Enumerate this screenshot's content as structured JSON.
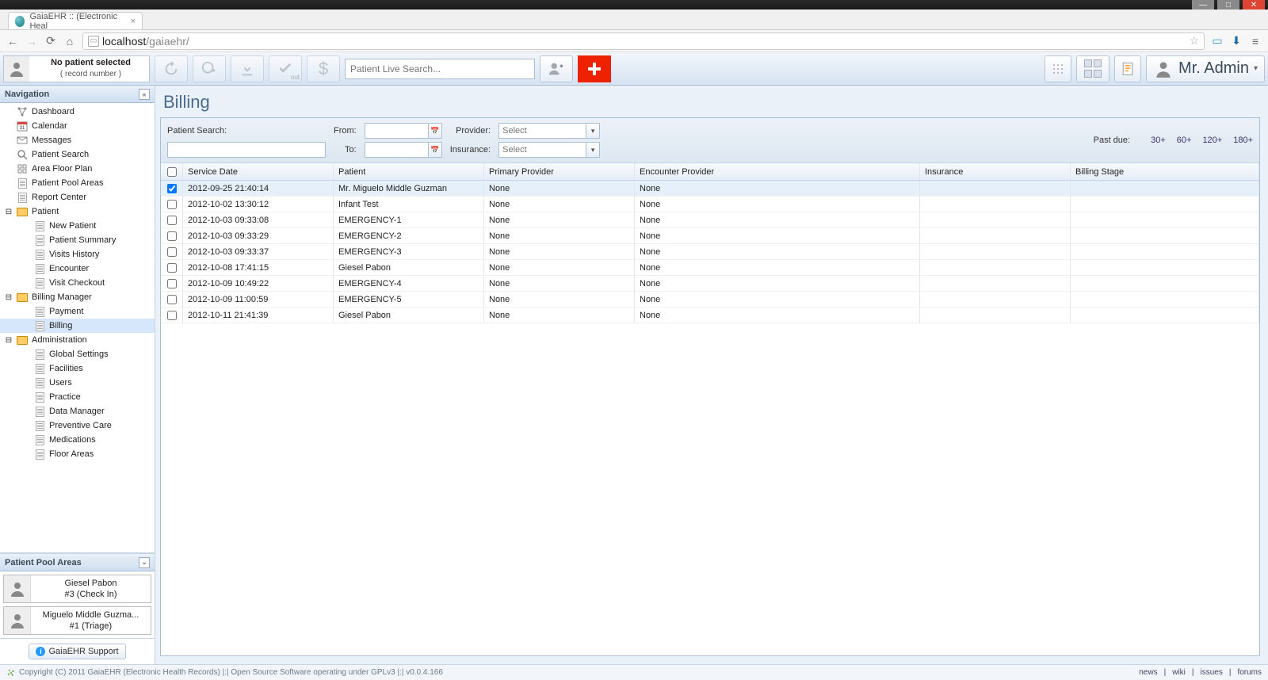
{
  "window": {
    "tab_title": "GaiaEHR :: (Electronic Heal",
    "url_host": "localhost",
    "url_path": "/gaiaehr/"
  },
  "toolbar": {
    "no_patient_line1": "No patient selected",
    "no_patient_line2": "( record number )",
    "search_placeholder": "Patient Live Search...",
    "checkout_sub": "out",
    "user_label": "Mr. Admin"
  },
  "nav_header": "Navigation",
  "nav": [
    {
      "id": "dashboard",
      "label": "Dashboard",
      "type": "item",
      "depth": 0,
      "icon": "nodes"
    },
    {
      "id": "calendar",
      "label": "Calendar",
      "type": "item",
      "depth": 0,
      "icon": "cal"
    },
    {
      "id": "messages",
      "label": "Messages",
      "type": "item",
      "depth": 0,
      "icon": "mail"
    },
    {
      "id": "psearch",
      "label": "Patient Search",
      "type": "item",
      "depth": 0,
      "icon": "search"
    },
    {
      "id": "floorplan",
      "label": "Area Floor Plan",
      "type": "item",
      "depth": 0,
      "icon": "grid"
    },
    {
      "id": "poolareas",
      "label": "Patient Pool Areas",
      "type": "item",
      "depth": 0,
      "icon": "doc"
    },
    {
      "id": "report",
      "label": "Report Center",
      "type": "item",
      "depth": 0,
      "icon": "doc"
    },
    {
      "id": "patient",
      "label": "Patient",
      "type": "folder",
      "depth": 0,
      "expanded": true
    },
    {
      "id": "newpatient",
      "label": "New Patient",
      "type": "item",
      "depth": 2,
      "icon": "doc"
    },
    {
      "id": "psummary",
      "label": "Patient Summary",
      "type": "item",
      "depth": 2,
      "icon": "doc"
    },
    {
      "id": "vhistory",
      "label": "Visits History",
      "type": "item",
      "depth": 2,
      "icon": "doc"
    },
    {
      "id": "encounter",
      "label": "Encounter",
      "type": "item",
      "depth": 2,
      "icon": "doc"
    },
    {
      "id": "vcheckout",
      "label": "Visit Checkout",
      "type": "item",
      "depth": 2,
      "icon": "doc"
    },
    {
      "id": "billingm",
      "label": "Billing Manager",
      "type": "folder",
      "depth": 0,
      "expanded": true
    },
    {
      "id": "payment",
      "label": "Payment",
      "type": "item",
      "depth": 2,
      "icon": "doc"
    },
    {
      "id": "billing",
      "label": "Billing",
      "type": "item",
      "depth": 2,
      "icon": "doc",
      "selected": true
    },
    {
      "id": "admin",
      "label": "Administration",
      "type": "folder",
      "depth": 0,
      "expanded": true
    },
    {
      "id": "gsettings",
      "label": "Global Settings",
      "type": "item",
      "depth": 2,
      "icon": "doc"
    },
    {
      "id": "facilities",
      "label": "Facilities",
      "type": "item",
      "depth": 2,
      "icon": "doc"
    },
    {
      "id": "users",
      "label": "Users",
      "type": "item",
      "depth": 2,
      "icon": "doc"
    },
    {
      "id": "practice",
      "label": "Practice",
      "type": "item",
      "depth": 2,
      "icon": "doc"
    },
    {
      "id": "dataman",
      "label": "Data Manager",
      "type": "item",
      "depth": 2,
      "icon": "doc"
    },
    {
      "id": "prevcare",
      "label": "Preventive Care",
      "type": "item",
      "depth": 2,
      "icon": "doc"
    },
    {
      "id": "meds",
      "label": "Medications",
      "type": "item",
      "depth": 2,
      "icon": "doc"
    },
    {
      "id": "floorareas",
      "label": "Floor Areas",
      "type": "item",
      "depth": 2,
      "icon": "doc"
    }
  ],
  "pool_header": "Patient Pool Areas",
  "pool": [
    {
      "name": "Giesel Pabon",
      "status": "#3 (Check In)"
    },
    {
      "name": "Miguelo Middle Guzma...",
      "status": "#1 (Triage)"
    }
  ],
  "support_label": "GaiaEHR Support",
  "page_title": "Billing",
  "filters": {
    "patient_search_label": "Patient Search:",
    "from_label": "From:",
    "to_label": "To:",
    "provider_label": "Provider:",
    "insurance_label": "Insurance:",
    "select_placeholder": "Select",
    "pastdue_label": "Past due:",
    "pastdue_options": [
      "30+",
      "60+",
      "120+",
      "180+"
    ]
  },
  "columns": {
    "service_date": "Service Date",
    "patient": "Patient",
    "primary_provider": "Primary Provider",
    "encounter_provider": "Encounter Provider",
    "insurance": "Insurance",
    "billing_stage": "Billing Stage"
  },
  "rows": [
    {
      "checked": true,
      "date": "2012-09-25 21:40:14",
      "patient": "Mr. Miguelo Middle Guzman",
      "pprov": "None",
      "eprov": "None",
      "ins": "",
      "stage": ""
    },
    {
      "checked": false,
      "date": "2012-10-02 13:30:12",
      "patient": "Infant Test",
      "pprov": "None",
      "eprov": "None",
      "ins": "",
      "stage": ""
    },
    {
      "checked": false,
      "date": "2012-10-03 09:33:08",
      "patient": "EMERGENCY-1",
      "pprov": "None",
      "eprov": "None",
      "ins": "",
      "stage": ""
    },
    {
      "checked": false,
      "date": "2012-10-03 09:33:29",
      "patient": "EMERGENCY-2",
      "pprov": "None",
      "eprov": "None",
      "ins": "",
      "stage": ""
    },
    {
      "checked": false,
      "date": "2012-10-03 09:33:37",
      "patient": "EMERGENCY-3",
      "pprov": "None",
      "eprov": "None",
      "ins": "",
      "stage": ""
    },
    {
      "checked": false,
      "date": "2012-10-08 17:41:15",
      "patient": "Giesel Pabon",
      "pprov": "None",
      "eprov": "None",
      "ins": "",
      "stage": ""
    },
    {
      "checked": false,
      "date": "2012-10-09 10:49:22",
      "patient": "EMERGENCY-4",
      "pprov": "None",
      "eprov": "None",
      "ins": "",
      "stage": ""
    },
    {
      "checked": false,
      "date": "2012-10-09 11:00:59",
      "patient": "EMERGENCY-5",
      "pprov": "None",
      "eprov": "None",
      "ins": "",
      "stage": ""
    },
    {
      "checked": false,
      "date": "2012-10-11 21:41:39",
      "patient": "Giesel Pabon",
      "pprov": "None",
      "eprov": "None",
      "ins": "",
      "stage": ""
    }
  ],
  "footer": {
    "copyright": "Copyright (C) 2011 GaiaEHR (Electronic Health Records) |:| Open Source Software operating under GPLv3 |:| v0.0.4.166",
    "links": [
      "news",
      "wiki",
      "issues",
      "forums"
    ]
  }
}
